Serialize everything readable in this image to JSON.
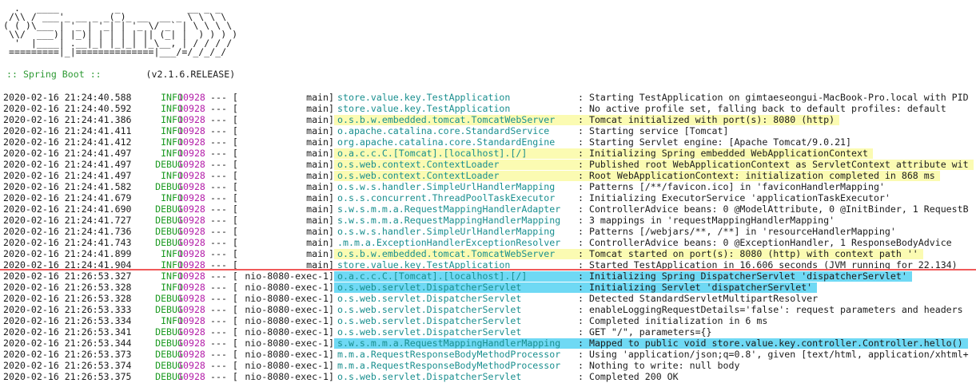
{
  "banner": {
    "art": "  .   ____          _            __ _ _\n /\\\\ / ___'_ __ _ _(_)_ __  __ _ \\ \\ \\ \\\n( ( )\\___ | '_ | '_| | '_ \\/ _` | \\ \\ \\ \\\n \\\\/  ___)| |_)| | | | | || (_| |  ) ) ) )\n  '  |____| .__|_| |_|_| |_\\__, | / / / /\n =========|_|==============|___/=/_/_/_/",
    "boot_label": ":: Spring Boot ::",
    "version": "(v2.1.6.RELEASE)"
  },
  "colors": {
    "highlight_yellow": "#fbfbb2",
    "highlight_cyan": "#6fd9f4",
    "divider": "#f05a5a",
    "logger": "#1a8f8f",
    "pid": "#b31da8",
    "level": "#1c9a22"
  },
  "log": [
    {
      "ts": "2020-02-16 21:24:40.588",
      "level": "INFO",
      "pid": "10928",
      "sep": "--- [",
      "thread": "main]",
      "logger": "store.value.key.TestApplication",
      "msg": ": Starting TestApplication on gimtaeseongui-MacBook-Pro.local with PID",
      "hl": ""
    },
    {
      "ts": "2020-02-16 21:24:40.592",
      "level": "INFO",
      "pid": "10928",
      "sep": "--- [",
      "thread": "main]",
      "logger": "store.value.key.TestApplication",
      "msg": ": No active profile set, falling back to default profiles: default",
      "hl": ""
    },
    {
      "ts": "2020-02-16 21:24:41.386",
      "level": "INFO",
      "pid": "10928",
      "sep": "--- [",
      "thread": "main]",
      "logger": "o.s.b.w.embedded.tomcat.TomcatWebServer",
      "msg": ": Tomcat initialized with port(s): 8080 (http)",
      "hl": "y"
    },
    {
      "ts": "2020-02-16 21:24:41.411",
      "level": "INFO",
      "pid": "10928",
      "sep": "--- [",
      "thread": "main]",
      "logger": "o.apache.catalina.core.StandardService",
      "msg": ": Starting service [Tomcat]",
      "hl": ""
    },
    {
      "ts": "2020-02-16 21:24:41.412",
      "level": "INFO",
      "pid": "10928",
      "sep": "--- [",
      "thread": "main]",
      "logger": "org.apache.catalina.core.StandardEngine",
      "msg": ": Starting Servlet engine: [Apache Tomcat/9.0.21]",
      "hl": ""
    },
    {
      "ts": "2020-02-16 21:24:41.497",
      "level": "INFO",
      "pid": "10928",
      "sep": "--- [",
      "thread": "main]",
      "logger": "o.a.c.c.C.[Tomcat].[localhost].[/]",
      "msg": ": Initializing Spring embedded WebApplicationContext",
      "hl": "y"
    },
    {
      "ts": "2020-02-16 21:24:41.497",
      "level": "DEBUG",
      "pid": "10928",
      "sep": "--- [",
      "thread": "main]",
      "logger": "o.s.web.context.ContextLoader",
      "msg": ": Published root WebApplicationContext as ServletContext attribute wit",
      "hl": "y"
    },
    {
      "ts": "2020-02-16 21:24:41.497",
      "level": "INFO",
      "pid": "10928",
      "sep": "--- [",
      "thread": "main]",
      "logger": "o.s.web.context.ContextLoader",
      "msg": ": Root WebApplicationContext: initialization completed in 868 ms",
      "hl": "y"
    },
    {
      "ts": "2020-02-16 21:24:41.582",
      "level": "DEBUG",
      "pid": "10928",
      "sep": "--- [",
      "thread": "main]",
      "logger": "o.s.w.s.handler.SimpleUrlHandlerMapping",
      "msg": ": Patterns [/**/favicon.ico] in 'faviconHandlerMapping'",
      "hl": ""
    },
    {
      "ts": "2020-02-16 21:24:41.679",
      "level": "INFO",
      "pid": "10928",
      "sep": "--- [",
      "thread": "main]",
      "logger": "o.s.s.concurrent.ThreadPoolTaskExecutor",
      "msg": ": Initializing ExecutorService 'applicationTaskExecutor'",
      "hl": ""
    },
    {
      "ts": "2020-02-16 21:24:41.690",
      "level": "DEBUG",
      "pid": "10928",
      "sep": "--- [",
      "thread": "main]",
      "logger": "s.w.s.m.m.a.RequestMappingHandlerAdapter",
      "msg": ": ControllerAdvice beans: 0 @ModelAttribute, 0 @InitBinder, 1 RequestB",
      "hl": ""
    },
    {
      "ts": "2020-02-16 21:24:41.727",
      "level": "DEBUG",
      "pid": "10928",
      "sep": "--- [",
      "thread": "main]",
      "logger": "s.w.s.m.m.a.RequestMappingHandlerMapping",
      "msg": ": 3 mappings in 'requestMappingHandlerMapping'",
      "hl": ""
    },
    {
      "ts": "2020-02-16 21:24:41.736",
      "level": "DEBUG",
      "pid": "10928",
      "sep": "--- [",
      "thread": "main]",
      "logger": "o.s.w.s.handler.SimpleUrlHandlerMapping",
      "msg": ": Patterns [/webjars/**, /**] in 'resourceHandlerMapping'",
      "hl": ""
    },
    {
      "ts": "2020-02-16 21:24:41.743",
      "level": "DEBUG",
      "pid": "10928",
      "sep": "--- [",
      "thread": "main]",
      "logger": ".m.m.a.ExceptionHandlerExceptionResolver",
      "msg": ": ControllerAdvice beans: 0 @ExceptionHandler, 1 ResponseBodyAdvice",
      "hl": ""
    },
    {
      "ts": "2020-02-16 21:24:41.899",
      "level": "INFO",
      "pid": "10928",
      "sep": "--- [",
      "thread": "main]",
      "logger": "o.s.b.w.embedded.tomcat.TomcatWebServer",
      "msg": ": Tomcat started on port(s): 8080 (http) with context path ''",
      "hl": "y"
    },
    {
      "ts": "2020-02-16 21:24:41.904",
      "level": "INFO",
      "pid": "10928",
      "sep": "--- [",
      "thread": "main]",
      "logger": "store.value.key.TestApplication",
      "msg": ": Started TestApplication in 16.606 seconds (JVM running for 22.134)",
      "hl": ""
    },
    {
      "ts": "2020-02-16 21:26:53.327",
      "level": "INFO",
      "pid": "10928",
      "sep": "--- [",
      "thread": "nio-8080-exec-1]",
      "logger": "o.a.c.c.C.[Tomcat].[localhost].[/]",
      "msg": ": Initializing Spring DispatcherServlet 'dispatcherServlet'",
      "hl": "c"
    },
    {
      "ts": "2020-02-16 21:26:53.328",
      "level": "INFO",
      "pid": "10928",
      "sep": "--- [",
      "thread": "nio-8080-exec-1]",
      "logger": "o.s.web.servlet.DispatcherServlet",
      "msg": ": Initializing Servlet 'dispatcherServlet'",
      "hl": "c"
    },
    {
      "ts": "2020-02-16 21:26:53.328",
      "level": "DEBUG",
      "pid": "10928",
      "sep": "--- [",
      "thread": "nio-8080-exec-1]",
      "logger": "o.s.web.servlet.DispatcherServlet",
      "msg": ": Detected StandardServletMultipartResolver",
      "hl": ""
    },
    {
      "ts": "2020-02-16 21:26:53.333",
      "level": "DEBUG",
      "pid": "10928",
      "sep": "--- [",
      "thread": "nio-8080-exec-1]",
      "logger": "o.s.web.servlet.DispatcherServlet",
      "msg": ": enableLoggingRequestDetails='false': request parameters and headers",
      "hl": ""
    },
    {
      "ts": "2020-02-16 21:26:53.334",
      "level": "INFO",
      "pid": "10928",
      "sep": "--- [",
      "thread": "nio-8080-exec-1]",
      "logger": "o.s.web.servlet.DispatcherServlet",
      "msg": ": Completed initialization in 6 ms",
      "hl": ""
    },
    {
      "ts": "2020-02-16 21:26:53.341",
      "level": "DEBUG",
      "pid": "10928",
      "sep": "--- [",
      "thread": "nio-8080-exec-1]",
      "logger": "o.s.web.servlet.DispatcherServlet",
      "msg": ": GET \"/\", parameters={}",
      "hl": ""
    },
    {
      "ts": "2020-02-16 21:26:53.344",
      "level": "DEBUG",
      "pid": "10928",
      "sep": "--- [",
      "thread": "nio-8080-exec-1]",
      "logger": "s.w.s.m.m.a.RequestMappingHandlerMapping",
      "msg": ": Mapped to public void store.value.key.controller.Controller.hello()",
      "hl": "c"
    },
    {
      "ts": "2020-02-16 21:26:53.373",
      "level": "DEBUG",
      "pid": "10928",
      "sep": "--- [",
      "thread": "nio-8080-exec-1]",
      "logger": "m.m.a.RequestResponseBodyMethodProcessor",
      "msg": ": Using 'application/json;q=0.8', given [text/html, application/xhtml+",
      "hl": ""
    },
    {
      "ts": "2020-02-16 21:26:53.374",
      "level": "DEBUG",
      "pid": "10928",
      "sep": "--- [",
      "thread": "nio-8080-exec-1]",
      "logger": "m.m.a.RequestResponseBodyMethodProcessor",
      "msg": ": Nothing to write: null body",
      "hl": ""
    },
    {
      "ts": "2020-02-16 21:26:53.375",
      "level": "DEBUG",
      "pid": "10928",
      "sep": "--- [",
      "thread": "nio-8080-exec-1]",
      "logger": "o.s.web.servlet.DispatcherServlet",
      "msg": ": Completed 200 OK",
      "hl": ""
    }
  ]
}
